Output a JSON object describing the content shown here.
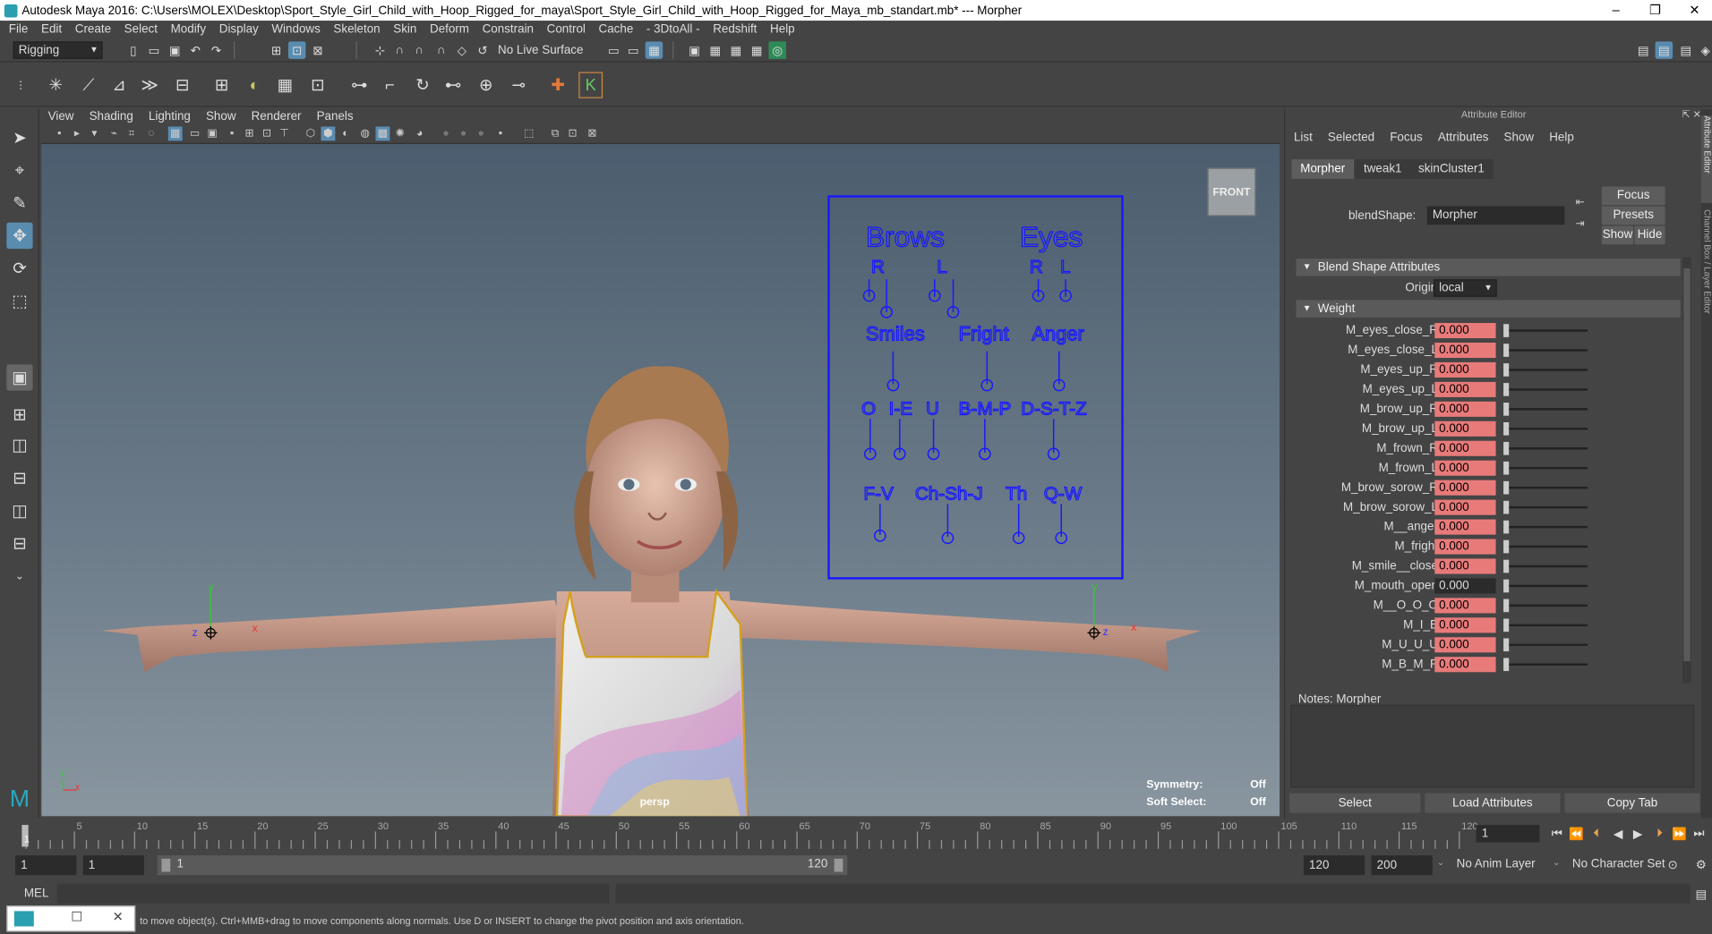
{
  "window": {
    "title": "Autodesk Maya 2016: C:\\Users\\MOLEX\\Desktop\\Sport_Style_Girl_Child_with_Hoop_Rigged_for_maya\\Sport_Style_Girl_Child_with_Hoop_Rigged_for_Maya_mb_standart.mb*   ---   Morpher",
    "minimize": "–",
    "restore": "❐",
    "close": "✕"
  },
  "menu": [
    "File",
    "Edit",
    "Create",
    "Select",
    "Modify",
    "Display",
    "Windows",
    "Skeleton",
    "Skin",
    "Deform",
    "Constrain",
    "Control",
    "Cache",
    "- 3DtoAll -",
    "Redshift",
    "Help"
  ],
  "status": {
    "mode": "Rigging",
    "live_surface": "No Live Surface"
  },
  "viewport": {
    "menu": [
      "View",
      "Shading",
      "Lighting",
      "Show",
      "Renderer",
      "Panels"
    ],
    "camera": "persp",
    "cube_label": "FRONT",
    "symmetry_label": "Symmetry:",
    "symmetry_value": "Off",
    "softselect_label": "Soft Select:",
    "softselect_value": "Off",
    "axis_y": "y",
    "axis_x": "x",
    "axis_z": "z"
  },
  "rig": {
    "brows": "Brows",
    "eyes": "Eyes",
    "r1": "R",
    "l1": "L",
    "r2": "R",
    "l2": "L",
    "smiles": "Smiles",
    "fright": "Fright",
    "anger": "Anger",
    "o": "O",
    "ie": "I-E",
    "u": "U",
    "bmp": "B-M-P",
    "dstz": "D-S-T-Z",
    "fv": "F-V",
    "chshj": "Ch-Sh-J",
    "th": "Th",
    "qw": "Q-W"
  },
  "attr": {
    "header": "Attribute Editor",
    "menu": [
      "List",
      "Selected",
      "Focus",
      "Attributes",
      "Show",
      "Help"
    ],
    "tabs": [
      "Morpher",
      "tweak1",
      "skinCluster1"
    ],
    "focus_btn": "Focus",
    "presets_btn": "Presets",
    "show_btn": "Show",
    "hide_btn": "Hide",
    "blendshape_label": "blendShape:",
    "blendshape_value": "Morpher",
    "section_bs": "Blend Shape Attributes",
    "origin_label": "Origin",
    "origin_value": "local",
    "section_weight": "Weight",
    "weights": [
      {
        "name": "M_eyes_close_R",
        "value": "0.000"
      },
      {
        "name": "M_eyes_close_L",
        "value": "0.000"
      },
      {
        "name": "M_eyes_up_R",
        "value": "0.000"
      },
      {
        "name": "M_eyes_up_L",
        "value": "0.000"
      },
      {
        "name": "M_brow_up_R",
        "value": "0.000"
      },
      {
        "name": "M_brow_up_L",
        "value": "0.000"
      },
      {
        "name": "M_frown_R",
        "value": "0.000"
      },
      {
        "name": "M_frown_L",
        "value": "0.000"
      },
      {
        "name": "M_brow_sorow_R",
        "value": "0.000"
      },
      {
        "name": "M_brow_sorow_L",
        "value": "0.000"
      },
      {
        "name": "M__anger",
        "value": "0.000"
      },
      {
        "name": "M_fright",
        "value": "0.000"
      },
      {
        "name": "M_smile__close",
        "value": "0.000"
      },
      {
        "name": "M_mouth_open",
        "value": "0.000"
      },
      {
        "name": "M__O_O_O",
        "value": "0.000"
      },
      {
        "name": "M_I_E",
        "value": "0.000"
      },
      {
        "name": "M_U_U_U",
        "value": "0.000"
      },
      {
        "name": "M_B_M_P",
        "value": "0.000"
      }
    ],
    "notes_label": "Notes:  Morpher",
    "select_btn": "Select",
    "load_btn": "Load Attributes",
    "copy_btn": "Copy Tab",
    "side_tab1": "Attribute Editor",
    "side_tab2": "Channel Box / Layer Editor"
  },
  "timeline": {
    "ticks": [
      "5",
      "10",
      "15",
      "20",
      "25",
      "30",
      "35",
      "40",
      "45",
      "50",
      "55",
      "60",
      "65",
      "70",
      "75",
      "80",
      "85",
      "90",
      "95",
      "100",
      "105",
      "110",
      "115",
      "120"
    ],
    "current": "1",
    "frame_field": "1"
  },
  "range": {
    "start": "1",
    "anim_start": "1",
    "slider_start": "1",
    "slider_end": "120",
    "end": "120",
    "anim_end": "200",
    "anim_layer": "No Anim Layer",
    "char_set": "No Character Set"
  },
  "cmd": {
    "label": "MEL"
  },
  "help": {
    "text": "to move object(s). Ctrl+MMB+drag to move components along normals. Use D or INSERT to change the pivot position and axis orientation."
  }
}
